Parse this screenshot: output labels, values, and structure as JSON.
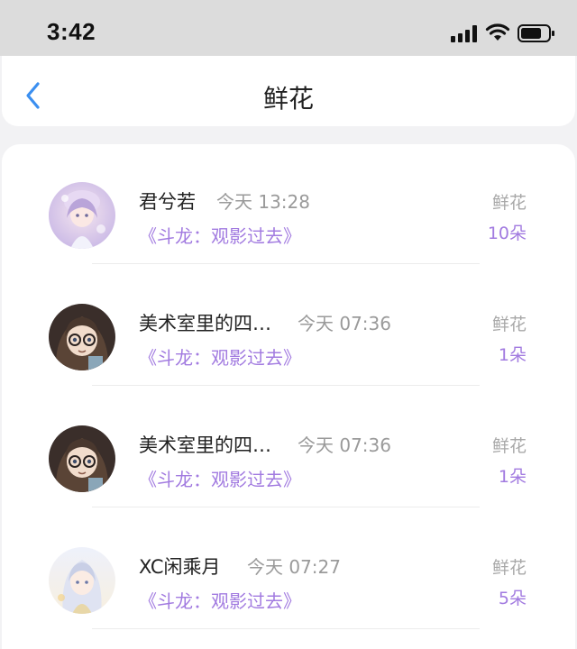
{
  "status_bar": {
    "time": "3:42"
  },
  "header": {
    "title": "鲜花"
  },
  "items": [
    {
      "name": "君兮若",
      "time": "今天 13:28",
      "book": "《斗龙：观影过去》",
      "gift": "鲜花",
      "count": "10朵",
      "avatar": "avatar-girl-pastel"
    },
    {
      "name": "美术室里的四…",
      "time": "今天 07:36",
      "book": "《斗龙：观影过去》",
      "gift": "鲜花",
      "count": "1朵",
      "avatar": "avatar-glasses-girl"
    },
    {
      "name": "美术室里的四…",
      "time": "今天 07:36",
      "book": "《斗龙：观影过去》",
      "gift": "鲜花",
      "count": "1朵",
      "avatar": "avatar-glasses-girl"
    },
    {
      "name": "XC闲乘月",
      "time": "今天 07:27",
      "book": "《斗龙：观影过去》",
      "gift": "鲜花",
      "count": "5朵",
      "avatar": "avatar-white-hair-girl"
    }
  ]
}
